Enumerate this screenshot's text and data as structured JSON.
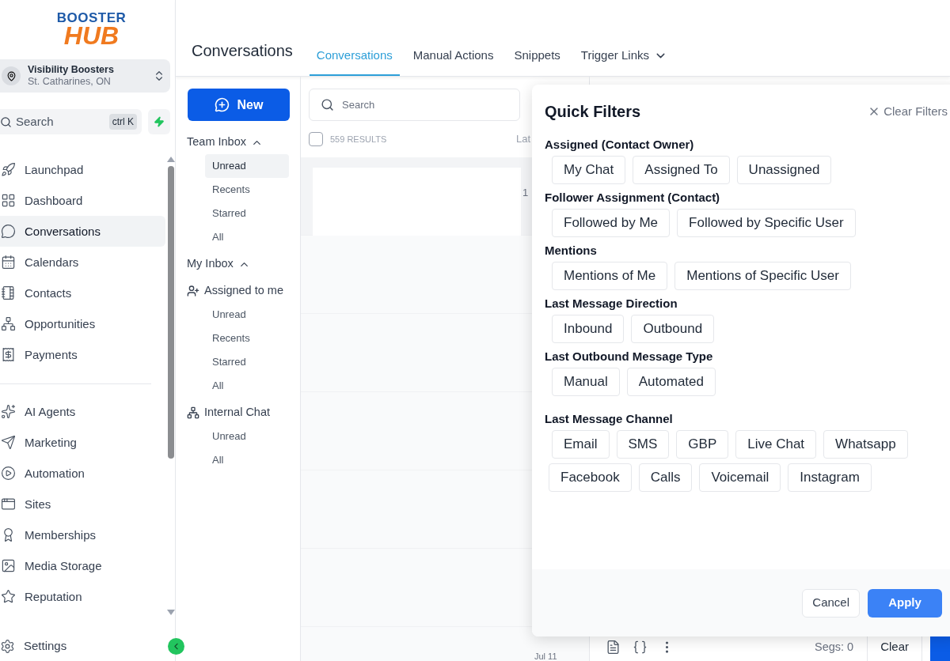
{
  "logo": {
    "top": "BOOSTER",
    "bottom": "HUB"
  },
  "account": {
    "name": "Visibility Boosters",
    "location": "St. Catharines, ON"
  },
  "sidebar_search": {
    "placeholder": "Search",
    "shortcut": "ctrl K"
  },
  "nav": [
    {
      "label": "Launchpad",
      "selected": false
    },
    {
      "label": "Dashboard",
      "selected": false
    },
    {
      "label": "Conversations",
      "selected": true
    },
    {
      "label": "Calendars",
      "selected": false
    },
    {
      "label": "Contacts",
      "selected": false
    },
    {
      "label": "Opportunities",
      "selected": false
    },
    {
      "label": "Payments",
      "selected": false
    }
  ],
  "nav_2": [
    {
      "label": "AI Agents",
      "selected": false
    },
    {
      "label": "Marketing",
      "selected": false
    },
    {
      "label": "Automation",
      "selected": false
    },
    {
      "label": "Sites",
      "selected": false
    },
    {
      "label": "Memberships",
      "selected": false
    },
    {
      "label": "Media Storage",
      "selected": false
    },
    {
      "label": "Reputation",
      "selected": false
    }
  ],
  "settings": {
    "label": "Settings"
  },
  "header": {
    "title": "Conversations"
  },
  "tabs": [
    {
      "label": "Conversations",
      "selected": true,
      "dropdown": false
    },
    {
      "label": "Manual Actions",
      "selected": false,
      "dropdown": false
    },
    {
      "label": "Snippets",
      "selected": false,
      "dropdown": false
    },
    {
      "label": "Trigger Links",
      "selected": false,
      "dropdown": true
    }
  ],
  "new_button": "New",
  "inbox_groups": [
    {
      "title": "Team Inbox",
      "kind": "section",
      "expanded": true,
      "items": [
        {
          "label": "Unread",
          "selected": true
        },
        {
          "label": "Recents",
          "selected": false
        },
        {
          "label": "Starred",
          "selected": false
        },
        {
          "label": "All",
          "selected": false
        }
      ]
    },
    {
      "title": "My Inbox",
      "kind": "section",
      "expanded": true
    },
    {
      "title": "Assigned to me",
      "kind": "user",
      "items": [
        {
          "label": "Unread",
          "selected": false
        },
        {
          "label": "Recents",
          "selected": false
        },
        {
          "label": "Starred",
          "selected": false
        },
        {
          "label": "All",
          "selected": false
        }
      ]
    },
    {
      "title": "Internal Chat",
      "kind": "chat",
      "items": [
        {
          "label": "Unread",
          "selected": false
        },
        {
          "label": "All",
          "selected": false
        }
      ]
    }
  ],
  "list": {
    "search_placeholder": "Search",
    "select_all": {
      "checked": false
    },
    "results": "559 RESULTS",
    "column_3": "Lat",
    "rows": [
      {
        "column_2": "1"
      }
    ],
    "last_date": "Jul 11"
  },
  "composer": {
    "segments": "Segs: 0",
    "clear": "Clear"
  },
  "quick_filters": {
    "title": "Quick Filters",
    "clear": "Clear Filters",
    "groups": [
      {
        "title": "Assigned (Contact Owner)",
        "rows": [
          [
            {
              "label": "My Chat",
              "selected": false
            },
            {
              "label": "Assigned To",
              "selected": false
            },
            {
              "label": "Unassigned",
              "selected": false
            }
          ]
        ]
      },
      {
        "title": "Follower Assignment (Contact)",
        "rows": [
          [
            {
              "label": "Followed by Me",
              "selected": false
            },
            {
              "label": "Followed by Specific User",
              "selected": false
            }
          ]
        ]
      },
      {
        "title": "Mentions",
        "rows": [
          [
            {
              "label": "Mentions of Me",
              "selected": false
            },
            {
              "label": "Mentions of Specific User",
              "selected": false
            }
          ]
        ]
      },
      {
        "title": "Last Message Direction",
        "rows": [
          [
            {
              "label": "Inbound",
              "selected": false
            },
            {
              "label": "Outbound",
              "selected": false
            }
          ]
        ]
      },
      {
        "title": "Last Outbound Message Type",
        "rows": [
          [
            {
              "label": "Manual",
              "selected": false
            },
            {
              "label": "Automated",
              "selected": false
            }
          ]
        ]
      },
      {
        "title": "Last Message Channel",
        "rows": [
          [
            {
              "label": "Email",
              "selected": false
            },
            {
              "label": "SMS",
              "selected": false
            },
            {
              "label": "GBP",
              "selected": false
            },
            {
              "label": "Live Chat",
              "selected": false
            },
            {
              "label": "Whatsapp",
              "selected": false
            }
          ],
          [
            {
              "label": "Facebook",
              "selected": false
            },
            {
              "label": "Calls",
              "selected": false
            },
            {
              "label": "Voicemail",
              "selected": false
            },
            {
              "label": "Instagram",
              "selected": false
            }
          ]
        ]
      }
    ],
    "cancel": "Cancel",
    "apply": "Apply"
  }
}
